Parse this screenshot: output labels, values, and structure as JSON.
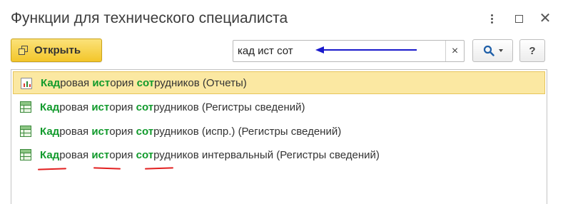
{
  "window": {
    "title": "Функции для технического специалиста",
    "controls": [
      "more-icon",
      "maximize-icon",
      "close-icon"
    ]
  },
  "toolbar": {
    "open_label": "Открыть",
    "search_value": "кад ист сот",
    "clear_glyph": "×",
    "help_label": "?"
  },
  "list": {
    "items": [
      {
        "p1": "Кад",
        "p2": "ровая ",
        "p3": "ист",
        "p4": "ория ",
        "p5": "сот",
        "p6": "рудников (Отчеты)",
        "icon": "report-icon",
        "selected": true
      },
      {
        "p1": "Кад",
        "p2": "ровая ",
        "p3": "ист",
        "p4": "ория ",
        "p5": "сот",
        "p6": "рудников (Регистры сведений)",
        "icon": "register-icon",
        "selected": false
      },
      {
        "p1": "Кад",
        "p2": "ровая ",
        "p3": "ист",
        "p4": "ория ",
        "p5": "сот",
        "p6": "рудников (испр.) (Регистры сведений)",
        "icon": "register-icon",
        "selected": false
      },
      {
        "p1": "Кад",
        "p2": "ровая ",
        "p3": "ист",
        "p4": "ория ",
        "p5": "сот",
        "p6": "рудников интервальный (Регистры сведений)",
        "icon": "register-icon",
        "selected": false
      }
    ]
  },
  "colors": {
    "accent_yellow": "#f3c62a",
    "selection": "#fbe8a2",
    "match_green": "#119a2c",
    "annotation_arrow": "#1a1acc",
    "annotation_underline": "#e22020"
  }
}
